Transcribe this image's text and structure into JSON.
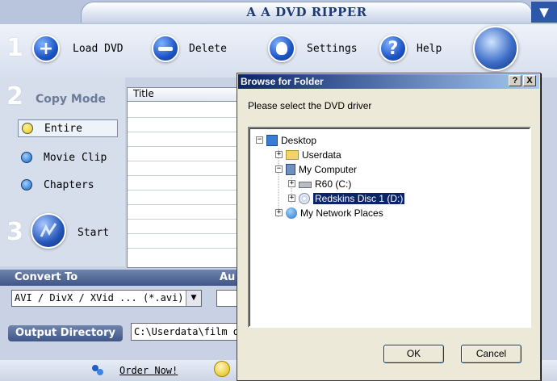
{
  "app": {
    "title": "A A DVD RIPPER"
  },
  "toolbar": {
    "load_label": "Load DVD",
    "delete_label": "Delete",
    "settings_label": "Settings",
    "help_label": "Help"
  },
  "steps": {
    "one": "1",
    "two": "2",
    "three": "3"
  },
  "copy_mode": {
    "label": "Copy Mode",
    "options": [
      {
        "label": "Entire",
        "selected": true
      },
      {
        "label": "Movie Clip",
        "selected": false
      },
      {
        "label": "Chapters",
        "selected": false
      }
    ],
    "start_label": "Start"
  },
  "titles_table": {
    "header": "Title"
  },
  "convert": {
    "label": "Convert To",
    "format": "AVI / DivX / XVid ... (*.avi)",
    "audio_label": "Au"
  },
  "output": {
    "label": "Output Directory",
    "path": "C:\\Userdata\\film d"
  },
  "bottom": {
    "order_label": "Order Now!"
  },
  "dialog": {
    "title": "Browse for Folder",
    "help_btn": "?",
    "close_btn": "X",
    "prompt": "Please select the DVD driver",
    "tree": {
      "desktop": "Desktop",
      "userdata": "Userdata",
      "my_computer": "My Computer",
      "drive_c": "R60 (C:)",
      "drive_d": "Redskins Disc 1 (D:)",
      "network": "My Network Places"
    },
    "ok_label": "OK",
    "cancel_label": "Cancel"
  },
  "colors": {
    "accent": "#2d57a8",
    "dialog_title": "#0a246a",
    "selection": "#0a246a"
  }
}
